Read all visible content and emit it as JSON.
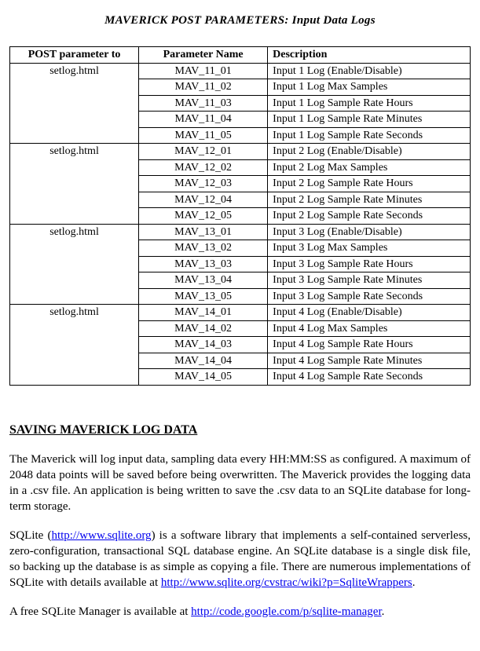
{
  "title": "MAVERICK POST PARAMETERS:  Input Data Logs",
  "table": {
    "headers": {
      "post": "POST parameter to",
      "param": "Parameter Name",
      "desc": "Description"
    },
    "groups": [
      {
        "post": "setlog.html",
        "rows": [
          {
            "param": "MAV_11_01",
            "desc": "Input 1 Log (Enable/Disable)"
          },
          {
            "param": "MAV_11_02",
            "desc": "Input 1 Log Max Samples"
          },
          {
            "param": "MAV_11_03",
            "desc": "Input 1 Log Sample Rate Hours"
          },
          {
            "param": "MAV_11_04",
            "desc": "Input 1 Log Sample Rate Minutes"
          },
          {
            "param": "MAV_11_05",
            "desc": "Input 1 Log Sample Rate Seconds"
          }
        ]
      },
      {
        "post": "setlog.html",
        "rows": [
          {
            "param": "MAV_12_01",
            "desc": "Input 2 Log (Enable/Disable)"
          },
          {
            "param": "MAV_12_02",
            "desc": "Input 2 Log Max Samples"
          },
          {
            "param": "MAV_12_03",
            "desc": "Input 2 Log Sample Rate Hours"
          },
          {
            "param": "MAV_12_04",
            "desc": "Input 2 Log Sample Rate Minutes"
          },
          {
            "param": "MAV_12_05",
            "desc": "Input 2 Log Sample Rate Seconds"
          }
        ]
      },
      {
        "post": "setlog.html",
        "rows": [
          {
            "param": "MAV_13_01",
            "desc": "Input 3 Log (Enable/Disable)"
          },
          {
            "param": "MAV_13_02",
            "desc": "Input 3 Log Max Samples"
          },
          {
            "param": "MAV_13_03",
            "desc": "Input 3 Log Sample Rate Hours"
          },
          {
            "param": "MAV_13_04",
            "desc": "Input 3 Log Sample Rate Minutes"
          },
          {
            "param": "MAV_13_05",
            "desc": "Input 3 Log Sample Rate Seconds"
          }
        ]
      },
      {
        "post": "setlog.html",
        "rows": [
          {
            "param": "MAV_14_01",
            "desc": "Input 4 Log (Enable/Disable)"
          },
          {
            "param": "MAV_14_02",
            "desc": "Input 4 Log Max Samples"
          },
          {
            "param": "MAV_14_03",
            "desc": "Input 4 Log Sample Rate Hours"
          },
          {
            "param": "MAV_14_04",
            "desc": "Input 4 Log Sample Rate Minutes"
          },
          {
            "param": "MAV_14_05",
            "desc": "Input 4 Log Sample Rate Seconds"
          }
        ]
      }
    ]
  },
  "section_heading": "SAVING MAVERICK LOG DATA",
  "para1": "The Maverick will log input data, sampling data every HH:MM:SS as configured.  A maximum of 2048 data points will be saved before being overwritten.  The Maverick provides the logging data in a .csv file.  An application is being written to save the .csv data to an SQLite database for long-term storage.",
  "para2": {
    "pre": "SQLite (",
    "link1": "http://www.sqlite.org",
    "mid": ") is a software library that implements a self-contained serverless, zero-configuration, transactional SQL database engine.  An SQLite database is a single disk file, so backing up the database is as simple as copying a file.  There are numerous implementations of SQLite with details available at ",
    "link2": "http://www.sqlite.org/cvstrac/wiki?p=SqliteWrappers",
    "post": "."
  },
  "para3": {
    "pre": "A free SQLite Manager is available at ",
    "link": "http://code.google.com/p/sqlite-manager",
    "post": "."
  }
}
